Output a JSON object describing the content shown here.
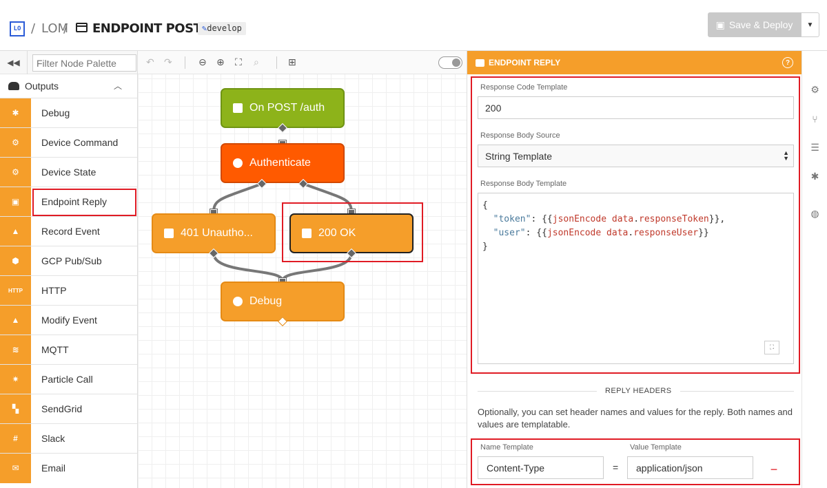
{
  "header": {
    "logo_text": "LO",
    "sep1": "/",
    "app_name": "LOM",
    "sep2": "/",
    "title": "ENDPOINT POST /AUTH",
    "branch": "develop",
    "deploy_label": "Save & Deploy"
  },
  "palette": {
    "filter_placeholder": "Filter Node Palette",
    "category": "Outputs",
    "items": [
      {
        "label": "Debug",
        "icon": "bug-icon",
        "glyph": "✱"
      },
      {
        "label": "Device Command",
        "icon": "device-command-icon",
        "glyph": "⚙"
      },
      {
        "label": "Device State",
        "icon": "device-state-icon",
        "glyph": "⚙"
      },
      {
        "label": "Endpoint Reply",
        "icon": "endpoint-reply-icon",
        "glyph": "▣"
      },
      {
        "label": "Record Event",
        "icon": "record-event-icon",
        "glyph": "▲"
      },
      {
        "label": "GCP Pub/Sub",
        "icon": "gcp-icon",
        "glyph": "⬢"
      },
      {
        "label": "HTTP",
        "icon": "http-icon",
        "glyph": "HTTP"
      },
      {
        "label": "Modify Event",
        "icon": "modify-event-icon",
        "glyph": "▲"
      },
      {
        "label": "MQTT",
        "icon": "mqtt-icon",
        "glyph": "≋"
      },
      {
        "label": "Particle Call",
        "icon": "particle-icon",
        "glyph": "✷"
      },
      {
        "label": "SendGrid",
        "icon": "sendgrid-icon",
        "glyph": "▚"
      },
      {
        "label": "Slack",
        "icon": "slack-icon",
        "glyph": "#"
      },
      {
        "label": "Email",
        "icon": "email-icon",
        "glyph": "✉"
      }
    ]
  },
  "canvas": {
    "nodes": {
      "trigger": "On POST /auth",
      "auth": "Authenticate",
      "unauth": "401 Unautho...",
      "ok": "200 OK",
      "debug": "Debug"
    }
  },
  "panel": {
    "title": "ENDPOINT REPLY",
    "response_code_label": "Response Code Template",
    "response_code_value": "200",
    "body_source_label": "Response Body Source",
    "body_source_value": "String Template",
    "body_template_label": "Response Body Template",
    "code_lines": {
      "l1": "{",
      "l2_key": "\"token\"",
      "l2_pre": "  ",
      "l2_mid": ": {{",
      "l2_fn": "jsonEncode",
      "l2_arg": " data",
      "l2_dot": ".",
      "l2_prop": "responseToken",
      "l2_end": "}},",
      "l3_key": "\"user\"",
      "l3_pre": "  ",
      "l3_mid": ": {{",
      "l3_fn": "jsonEncode",
      "l3_arg": " data",
      "l3_dot": ".",
      "l3_prop": "responseUser",
      "l3_end": "}}",
      "l4": "}"
    },
    "headers_section": "REPLY HEADERS",
    "headers_desc": "Optionally, you can set header names and values for the reply. Both names and values are templatable.",
    "name_label": "Name Template",
    "value_label": "Value Template",
    "header_name": "Content-Type",
    "header_eq": "=",
    "header_value": "application/json"
  },
  "colors": {
    "accent": "#f59e2a",
    "trigger": "#8db31a",
    "auth": "#ff5a00",
    "highlight": "#e01b24"
  }
}
